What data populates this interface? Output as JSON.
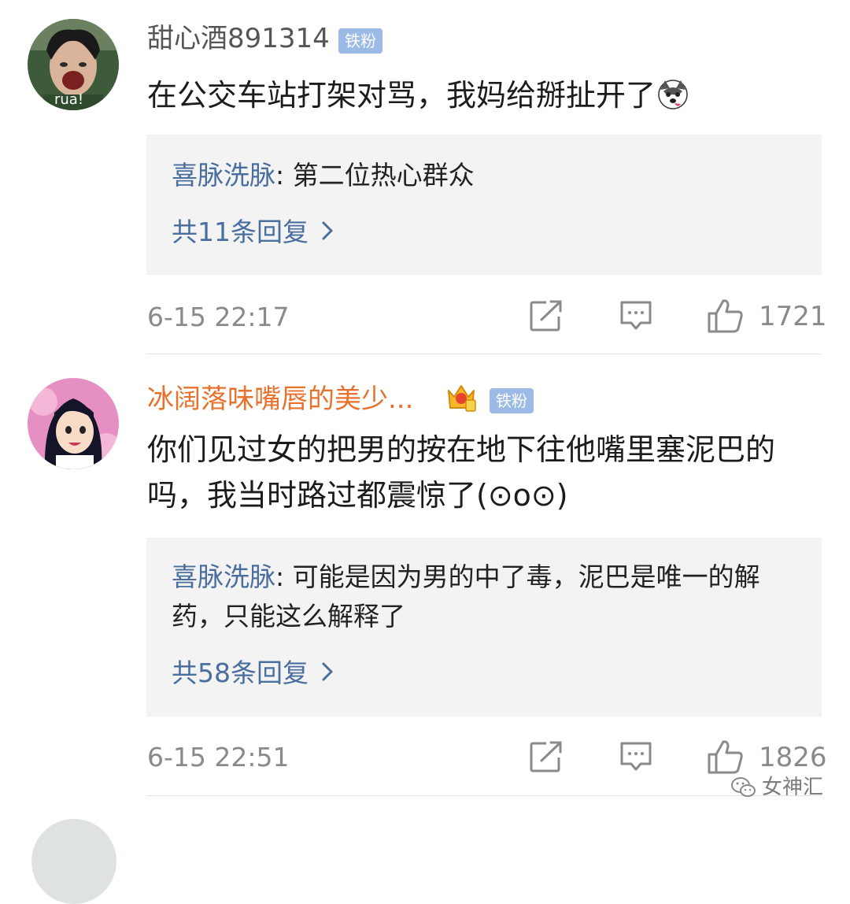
{
  "comments": [
    {
      "username": "甜心酒891314",
      "badge": "铁粉",
      "avatar_caption": "rua!",
      "text": "在公交车站打架对骂，我妈给掰扯开了",
      "emoji_icon": "husky-dog-emoji-icon",
      "reply_preview": {
        "author": "喜脉洗脉",
        "text": ": 第二位热心群众"
      },
      "reply_count_label": "共11条回复",
      "timestamp": "6-15 22:17",
      "likes": "1721"
    },
    {
      "username": "冰阔落味嘴唇的美少...",
      "badge": "铁粉",
      "crown_icon": "vip-crown-icon",
      "text": "你们见过女的把男的按在地下往他嘴里塞泥巴的吗，我当时路过都震惊了(⊙o⊙)",
      "reply_preview": {
        "author": "喜脉洗脉",
        "text": ": 可能是因为男的中了毒，泥巴是唯一的解药，只能这么解释了"
      },
      "reply_count_label": "共58条回复",
      "timestamp": "6-15 22:51",
      "likes": "1826"
    }
  ],
  "watermark": "女神汇",
  "colors": {
    "link_blue": "#4a6e9e",
    "username_orange": "#e8722c",
    "badge_blue": "#9bbbe6",
    "reply_bg": "#f3f3f3",
    "meta_gray": "#8a8a8a"
  }
}
